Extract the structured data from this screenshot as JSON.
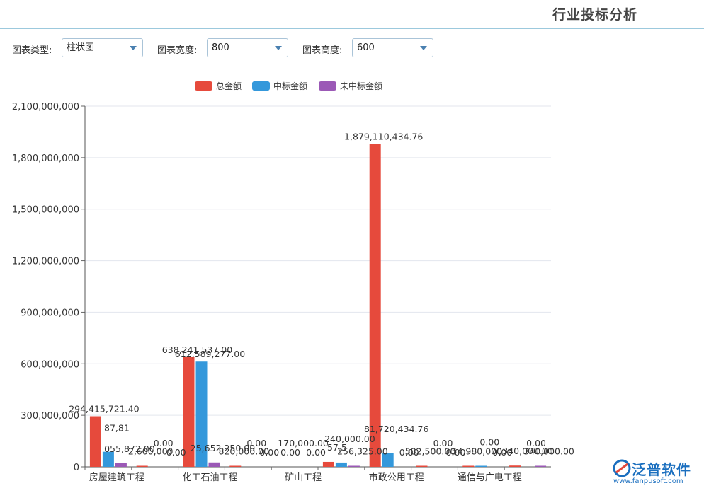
{
  "page": {
    "title": "行业投标分析"
  },
  "controls": {
    "chart_type_label": "图表类型:",
    "chart_type_value": "柱状图",
    "width_label": "图表宽度:",
    "width_value": "800",
    "height_label": "图表高度:",
    "height_value": "600"
  },
  "logo": {
    "name": "泛普软件",
    "url": "www.fanpusoft.com"
  },
  "colors": {
    "total": "#e64a3c",
    "won": "#3498db",
    "not_won": "#9b59b6",
    "accent": "#4a80b0"
  },
  "chart_data": {
    "type": "bar",
    "title": "",
    "xlabel": "",
    "ylabel": "",
    "ylim": [
      0,
      2100000000
    ],
    "yticks": [
      0,
      300000000,
      600000000,
      900000000,
      1200000000,
      1500000000,
      1800000000,
      2100000000
    ],
    "ytick_labels": [
      "0",
      "300,000,000",
      "600,000,000",
      "900,000,000",
      "1,200,000,000",
      "1,500,000,000",
      "1,800,000,000",
      "2,100,000,000"
    ],
    "grid": true,
    "legend_position": "top-center",
    "categories": [
      "房屋建筑工程",
      "",
      "化工石油工程",
      "",
      "矿山工程",
      "",
      "市政公用工程",
      "",
      "通信与广电工程",
      ""
    ],
    "series": [
      {
        "name": "总金额",
        "values": [
          294415721.4,
          2600000,
          638241537.0,
          820000,
          0,
          29000000,
          1879110434.76,
          582500,
          4980000,
          7340000
        ],
        "labels": [
          "294,415,721.40",
          "2,600,000",
          "638,241,537.00",
          "820,000.00",
          "0.00",
          "57,5",
          "1,879,110,434.76",
          "582,500.00",
          "54,980,000",
          "7,340,000.00"
        ]
      },
      {
        "name": "中标金额",
        "values": [
          87810558,
          0,
          612589277.0,
          0,
          0,
          25000000,
          81720434.76,
          0,
          2000000,
          0
        ],
        "labels": [
          "87,81",
          "0.00",
          "612,589,277.00",
          "0.00",
          "170,000.00",
          "240,000.00",
          "81,720,434.76",
          "0.00",
          "0.00",
          "0.00"
        ]
      },
      {
        "name": "未中标金额",
        "values": [
          20605872,
          0,
          25652250.0,
          0,
          0,
          256325.0,
          0,
          0,
          0,
          3340000
        ],
        "labels": [
          "055,872.00",
          "0.00",
          "25,652,250.00",
          "0.00",
          "0.00",
          "256,325.00",
          "0.00",
          "0.00",
          "0.00",
          "340,000.00"
        ]
      }
    ]
  }
}
